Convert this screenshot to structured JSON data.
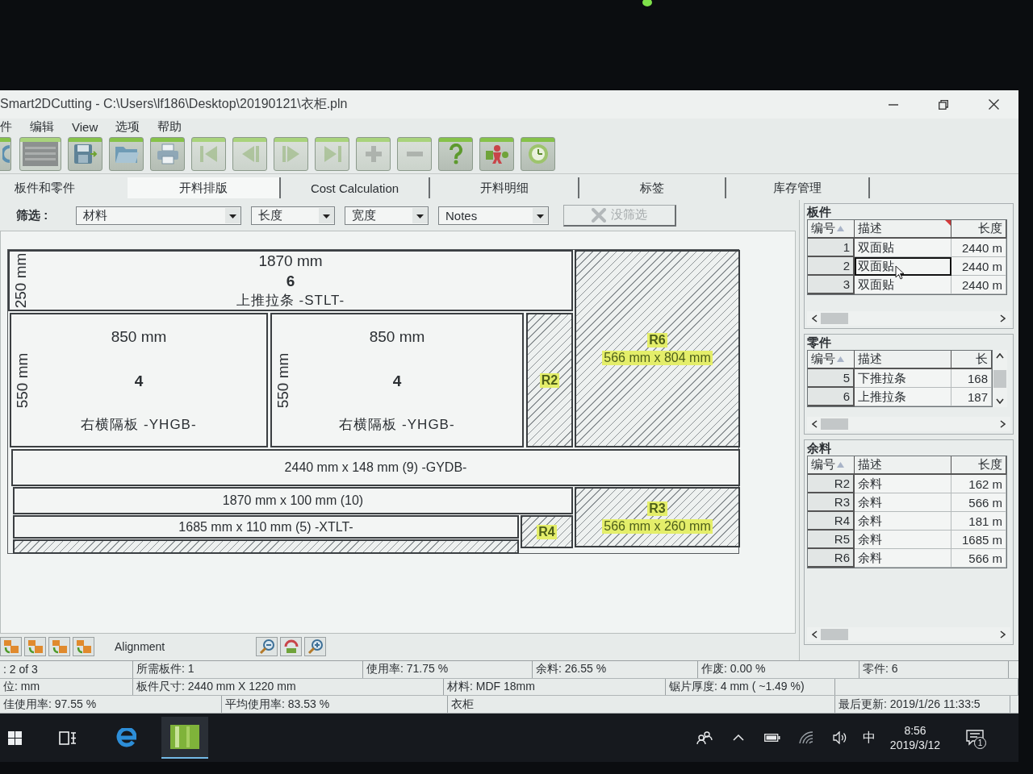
{
  "window": {
    "title": "Smart2DCutting - C:\\Users\\lf186\\Desktop\\20190121\\衣柜.pln"
  },
  "menu": [
    {
      "label": "件"
    },
    {
      "label": "编辑"
    },
    {
      "label": "View"
    },
    {
      "label": "选项"
    },
    {
      "label": "帮助"
    }
  ],
  "toolbar": [
    {
      "kind": "refresh",
      "disabled": false
    },
    {
      "kind": "image",
      "disabled": true
    },
    {
      "kind": "save",
      "disabled": false
    },
    {
      "kind": "open",
      "disabled": false
    },
    {
      "kind": "print",
      "disabled": false
    },
    {
      "kind": "first",
      "disabled": true
    },
    {
      "kind": "previous",
      "disabled": true
    },
    {
      "kind": "next",
      "disabled": true
    },
    {
      "kind": "last",
      "disabled": true
    },
    {
      "kind": "add",
      "disabled": true
    },
    {
      "kind": "remove",
      "disabled": true
    },
    {
      "kind": "help",
      "disabled": false
    },
    {
      "kind": "tool",
      "disabled": false
    },
    {
      "kind": "clock",
      "disabled": false
    }
  ],
  "tabs": [
    {
      "label": "板件和零件",
      "selected": false
    },
    {
      "label": "开料排版",
      "selected": true
    },
    {
      "label": "Cost Calculation",
      "selected": false
    },
    {
      "label": "开料明细",
      "selected": false
    },
    {
      "label": "标签",
      "selected": false
    },
    {
      "label": "库存管理",
      "selected": false
    }
  ],
  "filter": {
    "label": "筛选 :",
    "dropdowns": [
      {
        "value": "材料"
      },
      {
        "value": "长度"
      },
      {
        "value": "宽度"
      },
      {
        "value": "Notes"
      }
    ],
    "clear_button": {
      "label": "没筛选",
      "disabled": true
    }
  },
  "layout": {
    "pieces": [
      {
        "kind": "part",
        "width": "1870 mm",
        "height": "250 mm",
        "count": "6",
        "name": "上推拉条 -STLT-"
      },
      {
        "kind": "part",
        "width": "850 mm",
        "height": "550 mm",
        "count": "4",
        "name": "右横隔板 -YHGB-"
      },
      {
        "kind": "part",
        "width": "850 mm",
        "height": "550 mm",
        "count": "4",
        "name": "右横隔板 -YHGB-"
      },
      {
        "kind": "remnant",
        "label": "R2"
      },
      {
        "kind": "remnant",
        "label": "R6",
        "size": "566 mm x 804 mm"
      },
      {
        "kind": "strip",
        "label": "2440 mm x 148 mm (9) -GYDB-"
      },
      {
        "kind": "strip",
        "label": "1870 mm x 100 mm (10)"
      },
      {
        "kind": "strip",
        "label": "1685 mm x 110 mm (5) -XTLT-"
      },
      {
        "kind": "remnant",
        "label": "R4"
      },
      {
        "kind": "remnant",
        "label": "R3",
        "size": "566 mm x 260 mm"
      },
      {
        "kind": "remnant"
      }
    ]
  },
  "layout_tools": {
    "label": "Alignment"
  },
  "panels": [
    {
      "title": "板件",
      "columns": [
        "编号",
        "描述",
        "长度"
      ],
      "rows": [
        {
          "cells": [
            "1",
            "双面贴",
            "2440 m"
          ],
          "selected": false
        },
        {
          "cells": [
            "2",
            "双面贴",
            "2440 m"
          ],
          "selected": true
        },
        {
          "cells": [
            "3",
            "双面贴",
            "2440 m"
          ],
          "selected": false
        }
      ]
    },
    {
      "title": "零件",
      "columns": [
        "编号",
        "描述",
        "长"
      ],
      "rows": [
        {
          "cells": [
            "5",
            "下推拉条",
            "168"
          ],
          "selected": false
        },
        {
          "cells": [
            "6",
            "上推拉条",
            "187"
          ],
          "selected": false
        }
      ]
    },
    {
      "title": "余料",
      "columns": [
        "编号",
        "描述",
        "长度"
      ],
      "rows": [
        {
          "cells": [
            "R2",
            "余料",
            "162 m"
          ],
          "selected": false
        },
        {
          "cells": [
            "R3",
            "余料",
            "566 m"
          ],
          "selected": false
        },
        {
          "cells": [
            "R4",
            "余料",
            "181 m"
          ],
          "selected": false
        },
        {
          "cells": [
            "R5",
            "余料",
            "1685 m"
          ],
          "selected": false
        },
        {
          "cells": [
            "R6",
            "余料",
            "566 m"
          ],
          "selected": false
        }
      ]
    }
  ],
  "status_bar": {
    "fields": [
      ": 2 of 3",
      "所需板件: 1",
      "使用率: 71.75 %",
      "余料: 26.55 %",
      "作废: 0.00 %",
      "零件: 6",
      "位: mm",
      "板件尺寸: 2440 mm X 1220 mm",
      "材料: MDF 18mm",
      "锯片厚度: 4 mm ( ~1.49 %)",
      "佳使用率: 97.55 %",
      "平均使用率: 83.53 %",
      "衣柜",
      "最后更新: 2019/1/26 11:33:5"
    ]
  },
  "taskbar": {
    "ime": "中",
    "time": "8:56",
    "date": "2019/3/12",
    "notifications": "1"
  }
}
